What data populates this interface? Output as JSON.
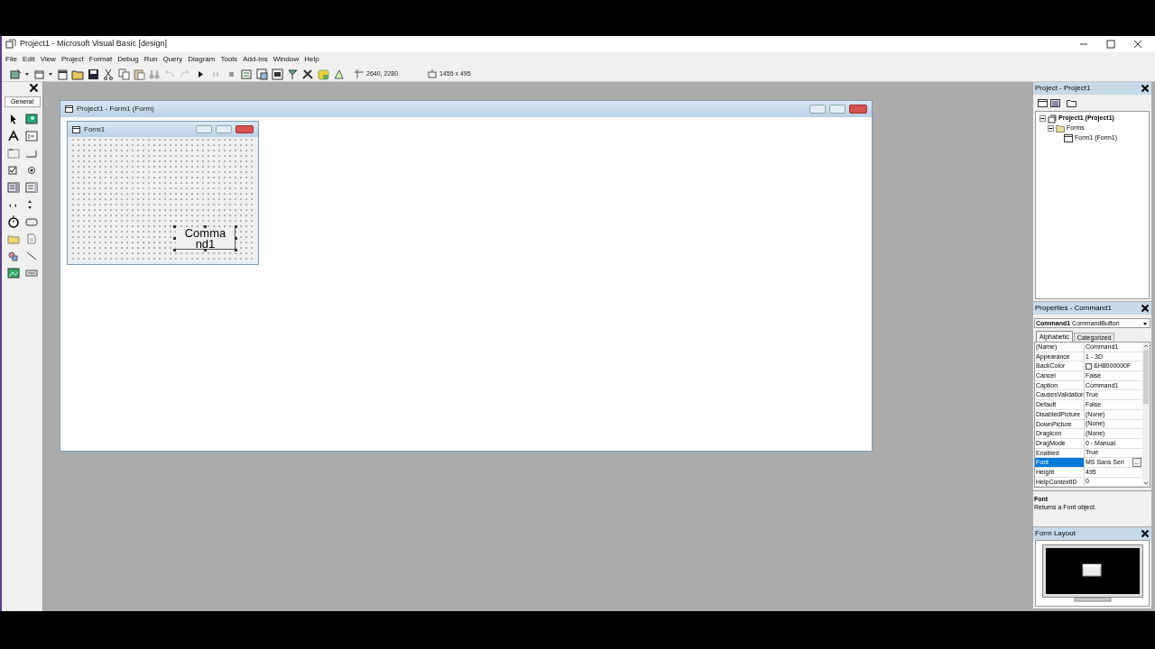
{
  "window": {
    "title": "Project1 - Microsoft Visual Basic [design]"
  },
  "menu": [
    {
      "label": "File"
    },
    {
      "label": "Edit"
    },
    {
      "label": "View"
    },
    {
      "label": "Project"
    },
    {
      "label": "Format"
    },
    {
      "label": "Debug"
    },
    {
      "label": "Run"
    },
    {
      "label": "Query"
    },
    {
      "label": "Diagram"
    },
    {
      "label": "Tools"
    },
    {
      "label": "Add-Ins"
    },
    {
      "label": "Window"
    },
    {
      "label": "Help"
    }
  ],
  "toolbar": {
    "position": "2640, 2280",
    "size": "1455 x 495"
  },
  "toolbox": {
    "tab": "General"
  },
  "designer": {
    "title": "Project1 - Form1 (Form)",
    "form": {
      "title": "Form1",
      "button": {
        "caption": "Command1",
        "selected": true
      }
    }
  },
  "project": {
    "title": "Project - Project1",
    "tree": [
      {
        "label": "Project1 (Project1)",
        "expanded": true,
        "children": [
          {
            "label": "Forms",
            "expanded": true,
            "children": [
              {
                "label": "Form1 (Form1)"
              }
            ]
          }
        ]
      }
    ]
  },
  "properties": {
    "title": "Properties - Command1",
    "object": "Command1",
    "object_type": "CommandButton",
    "tabs": [
      {
        "label": "Alphabetic",
        "selected": true
      },
      {
        "label": "Categorized",
        "selected": false
      }
    ],
    "rows": [
      {
        "name": "(Name)",
        "value": "Command1",
        "kind": "text",
        "selected": false
      },
      {
        "name": "Appearance",
        "value": "1 - 3D",
        "kind": "text",
        "selected": false
      },
      {
        "name": "BackColor",
        "value": "&H8000000F",
        "kind": "color",
        "color": "#f0f0f0",
        "selected": false
      },
      {
        "name": "Cancel",
        "value": "False",
        "kind": "text",
        "selected": false
      },
      {
        "name": "Caption",
        "value": "Command1",
        "kind": "text",
        "selected": false
      },
      {
        "name": "CausesValidation",
        "value": "True",
        "kind": "text",
        "selected": false
      },
      {
        "name": "Default",
        "value": "False",
        "kind": "text",
        "selected": false
      },
      {
        "name": "DisabledPicture",
        "value": "(None)",
        "kind": "text",
        "selected": false
      },
      {
        "name": "DownPicture",
        "value": "(None)",
        "kind": "text",
        "selected": false
      },
      {
        "name": "DragIcon",
        "value": "(None)",
        "kind": "text",
        "selected": false
      },
      {
        "name": "DragMode",
        "value": "0 - Manual",
        "kind": "text",
        "selected": false
      },
      {
        "name": "Enabled",
        "value": "True",
        "kind": "text",
        "selected": false
      },
      {
        "name": "Font",
        "value": "MS Sans Seri",
        "kind": "text",
        "selected": true,
        "button": "..."
      },
      {
        "name": "Height",
        "value": "495",
        "kind": "text",
        "selected": false
      },
      {
        "name": "HelpContextID",
        "value": "0",
        "kind": "text",
        "selected": false
      }
    ],
    "description": {
      "title": "Font",
      "text": "Returns a Font object."
    }
  },
  "form_layout": {
    "title": "Form Layout"
  }
}
